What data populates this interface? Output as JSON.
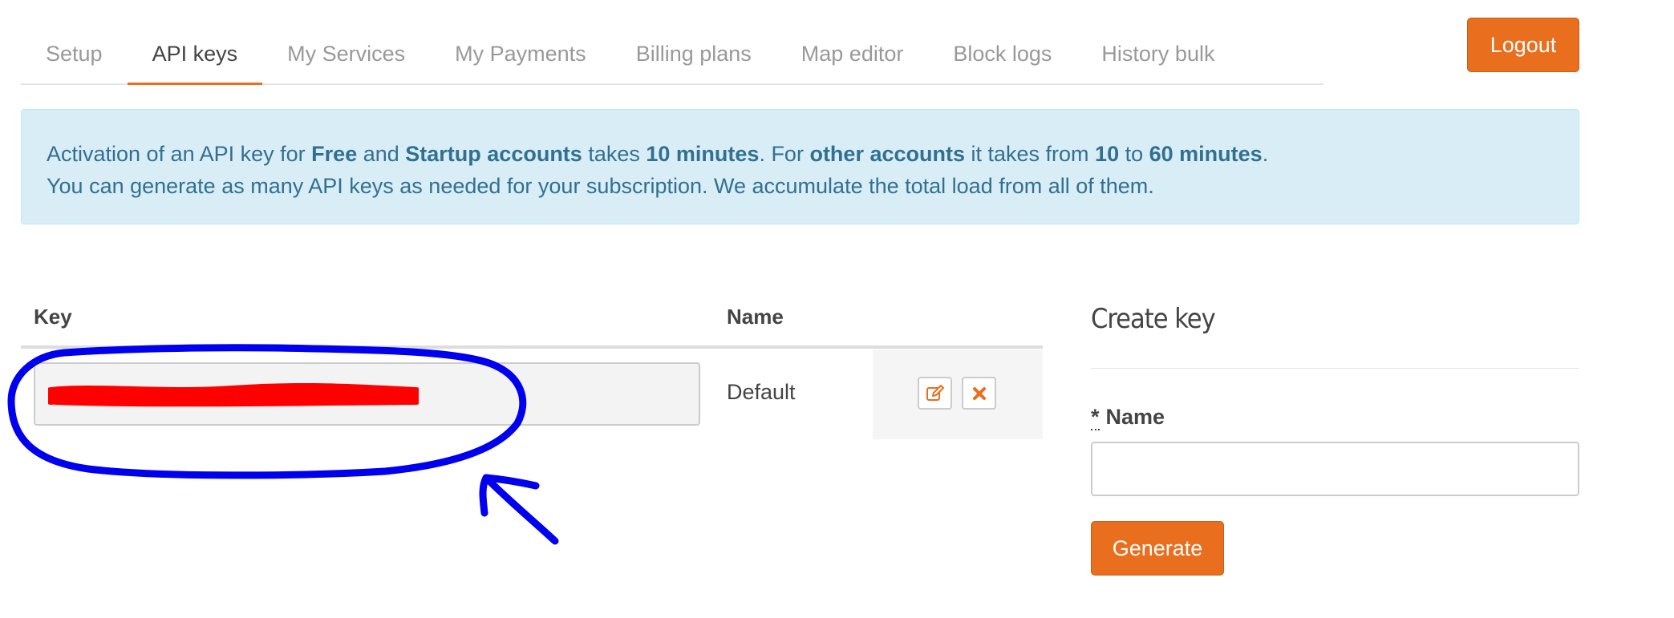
{
  "tabs": [
    {
      "label": "Setup",
      "active": false
    },
    {
      "label": "API keys",
      "active": true
    },
    {
      "label": "My Services",
      "active": false
    },
    {
      "label": "My Payments",
      "active": false
    },
    {
      "label": "Billing plans",
      "active": false
    },
    {
      "label": "Map editor",
      "active": false
    },
    {
      "label": "Block logs",
      "active": false
    },
    {
      "label": "History bulk",
      "active": false
    }
  ],
  "header": {
    "logout_label": "Logout"
  },
  "alert": {
    "line1": {
      "t1": "Activation of an API key for ",
      "b1": "Free",
      "t2": " and ",
      "b2": "Startup accounts",
      "t3": " takes ",
      "b3": "10 minutes",
      "t4": ". For ",
      "b4": "other accounts",
      "t5": " it takes from ",
      "b5": "10",
      "t6": " to ",
      "b6": "60 minutes",
      "t7": "."
    },
    "line2": "You can generate as many API keys as needed for your subscription. We accumulate the total load from all of them."
  },
  "keys_table": {
    "headers": {
      "key": "Key",
      "name": "Name"
    },
    "rows": [
      {
        "key_value": "",
        "name": "Default"
      }
    ]
  },
  "create_key": {
    "title": "Create key",
    "required_marker": "*",
    "name_label": "Name",
    "name_value": "",
    "generate_label": "Generate"
  },
  "colors": {
    "accent": "#e96e1e",
    "alert_bg": "#d9edf7",
    "alert_text": "#31708f",
    "annotation_circle": "#0000ee",
    "redaction": "#ff0000"
  },
  "icons": {
    "edit": "edit-icon",
    "delete": "close-icon"
  }
}
